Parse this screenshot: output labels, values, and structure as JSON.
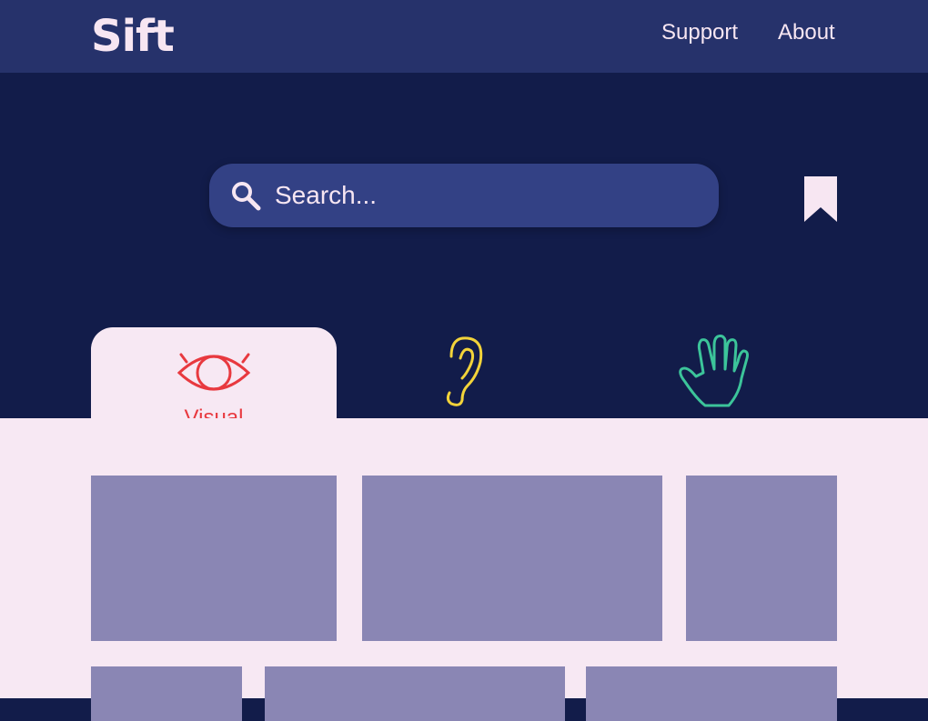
{
  "header": {
    "logo": "Sift",
    "nav": [
      {
        "label": "Support"
      },
      {
        "label": "About"
      }
    ]
  },
  "search": {
    "placeholder": "Search...",
    "icon": "search-icon"
  },
  "bookmark": {
    "icon": "bookmark-icon"
  },
  "tabs": [
    {
      "label": "Visual",
      "icon": "eye-icon",
      "color": "#e8393f",
      "active": true
    },
    {
      "label": "",
      "icon": "ear-icon",
      "color": "#f2d33a",
      "active": false
    },
    {
      "label": "",
      "icon": "hand-icon",
      "color": "#3cc49a",
      "active": false
    }
  ],
  "colors": {
    "header_bg": "#26326b",
    "hero_bg": "#121c4a",
    "search_bg": "#334185",
    "content_bg": "#f7e8f3",
    "card_bg": "#8a86b4",
    "text_light": "#f7e6f2"
  },
  "cards": {
    "count_visible": 6
  }
}
